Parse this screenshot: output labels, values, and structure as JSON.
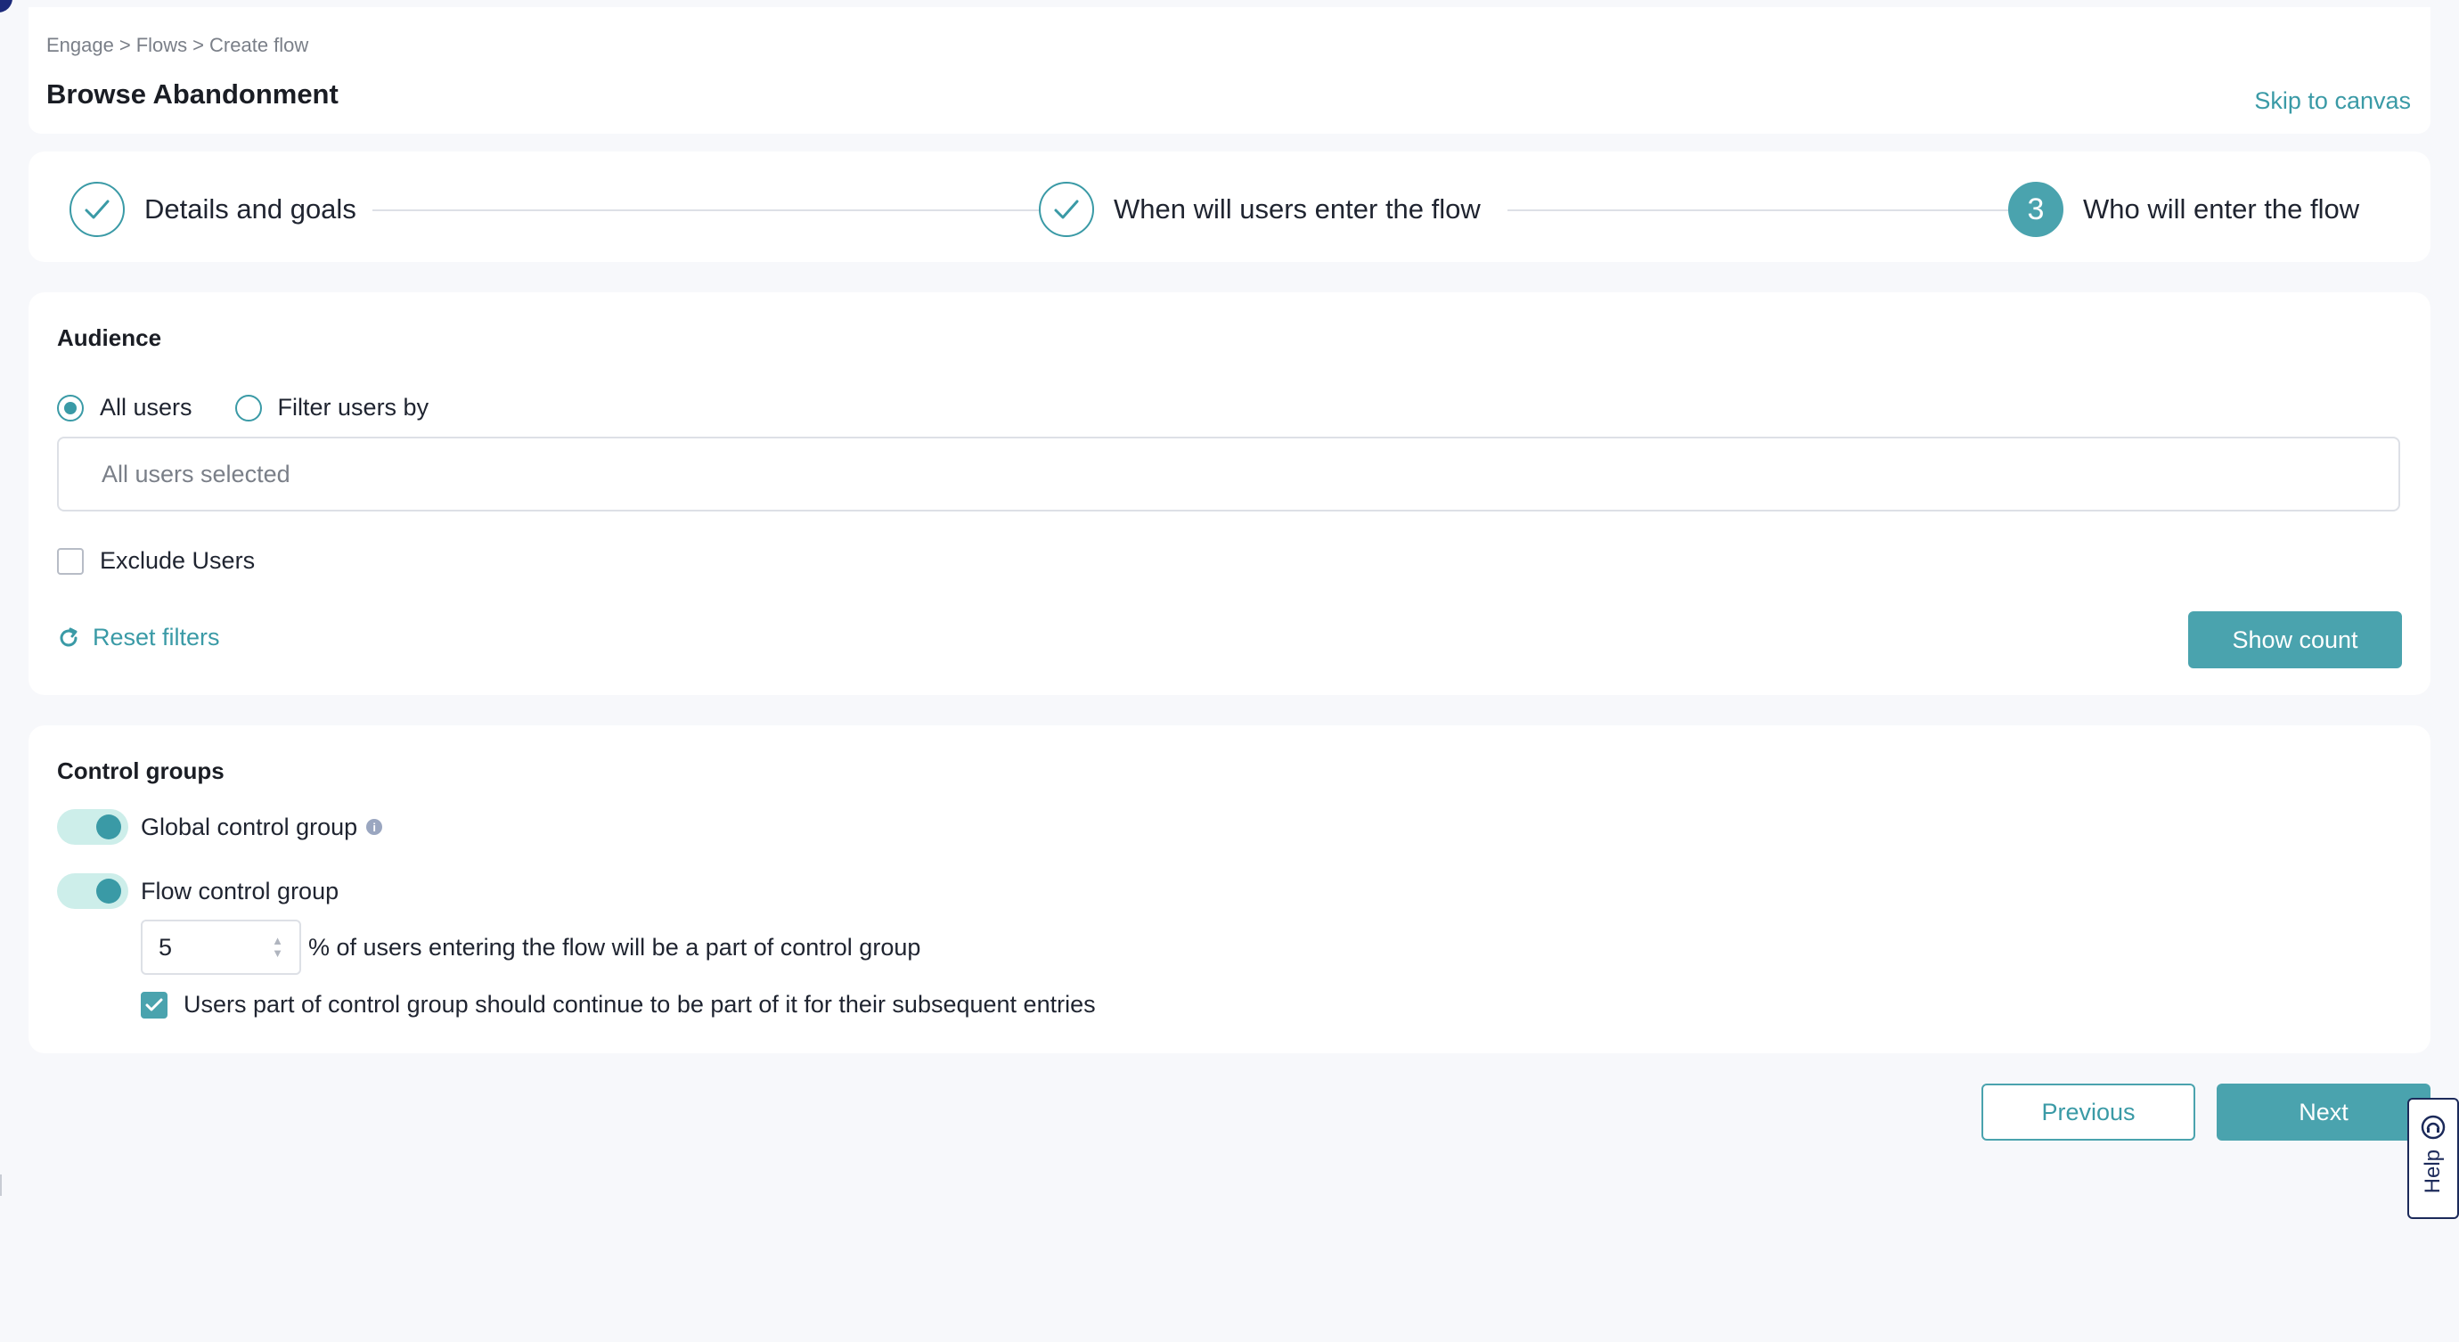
{
  "breadcrumb": {
    "items": [
      "Engage",
      "Flows",
      "Create flow"
    ],
    "separator": ">"
  },
  "page": {
    "title": "Browse Abandonment",
    "skip_link": "Skip to canvas"
  },
  "stepper": {
    "steps": [
      {
        "label": "Details and goals",
        "state": "complete",
        "icon": "check-icon"
      },
      {
        "label": "When will users enter the flow",
        "state": "complete",
        "icon": "check-icon"
      },
      {
        "label": "Who will enter the flow",
        "state": "active",
        "number": "3"
      }
    ]
  },
  "audience": {
    "title": "Audience",
    "options": [
      {
        "label": "All users",
        "selected": true
      },
      {
        "label": "Filter users by",
        "selected": false
      }
    ],
    "selection_text": "All users selected",
    "exclude_label": "Exclude Users",
    "exclude_checked": false,
    "reset_label": "Reset filters",
    "show_count_label": "Show count"
  },
  "control_groups": {
    "title": "Control groups",
    "global": {
      "label": "Global control group",
      "enabled": true,
      "info_icon": "info-icon"
    },
    "flow": {
      "label": "Flow control group",
      "enabled": true
    },
    "percentage_value": "5",
    "percentage_text": "% of users entering the flow will be a part of control group",
    "subsequent_label": "Users part of control group should continue to be part of it for their subsequent entries",
    "subsequent_checked": true
  },
  "footer": {
    "previous_label": "Previous",
    "next_label": "Next"
  },
  "help": {
    "label": "Help",
    "icon": "help-headset-icon"
  },
  "colors": {
    "accent": "#4aa3ae",
    "accent_text": "#3a9aa6",
    "toggle_track": "#cdeeea",
    "help_border": "#1c2a5a"
  }
}
